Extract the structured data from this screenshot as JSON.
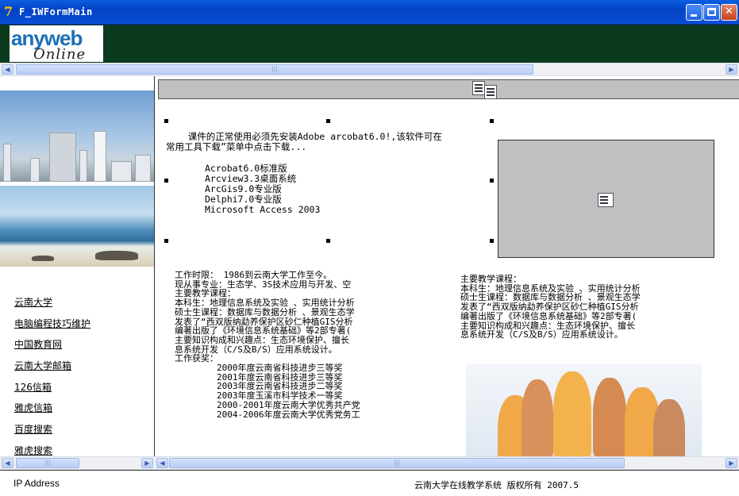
{
  "window": {
    "title": "F_IWFormMain",
    "icon": "delphi-app-icon"
  },
  "banner": {
    "logo_main": "anyweb",
    "logo_sub": "Online"
  },
  "sidebar": {
    "links": [
      {
        "label": "云南大学"
      },
      {
        "label": "电脑编程技巧维护"
      },
      {
        "label": "中国教育网"
      },
      {
        "label": "云南大学邮箱"
      },
      {
        "label": "126信箱"
      },
      {
        "label": "雅虎信箱"
      },
      {
        "label": "百度搜索"
      },
      {
        "label": "雅虎搜索"
      }
    ]
  },
  "content": {
    "notice": "    课件的正常使用必须先安装Adobe arcobat6.0!,该软件可在\n常用工具下载”菜单中点击下载...",
    "software": [
      "Acrobat6.0标准版",
      "Arcview3.3桌面系统",
      "ArcGis9.0专业版",
      "Delphi7.0专业版",
      "Microsoft Access 2003"
    ],
    "profile_left": "工作时限： 1986到云南大学工作至今。\n现从事专业：生态学、3S技术应用与开发、空\n主要教学课程：\n本科生：地理信息系统及实验 、实用统计分析\n硕士生课程：数据库与数据分析 、景观生态学\n发表了“西双版纳勐养保护区砂仁种植GIS分析\n编著出版了《环境信息系统基础》等2部专著(\n主要知识构成和兴趣点：生态环境保护、擅长\n息系统开发（C/S及B/S）应用系统设计。\n工作获奖：\n        2000年度云南省科技进步三等奖\n        2001年度云南省科技进步三等奖\n        2003年度云南省科技进步二等奖\n        2003年度玉溪市科学技术一等奖\n        2000-2001年度云南大学优秀共产党\n        2004-2006年度云南大学优秀党务工",
    "profile_right": "主要教学课程：\n本科生：地理信息系统及实验 、实用统计分析\n硕士生课程：数据库与数据分析 、景观生态学\n发表了“西双版纳勐养保护区砂仁种植GIS分析\n编著出版了《环境信息系统基础》等2部专著(\n主要知识构成和兴趣点：生态环境保护、擅长\n息系统开发（C/S及B/S）应用系统设计。"
  },
  "status": {
    "left": "IP Address",
    "right": "云南大学在线教学系统 版权所有 2007.5"
  },
  "colors": {
    "titlebar": "#0a4fd6",
    "banner": "#0b3a1f",
    "panel_gray": "#c0c0c0"
  }
}
